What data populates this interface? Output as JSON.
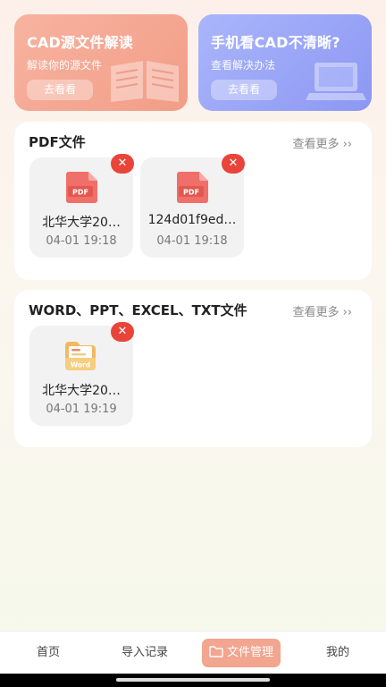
{
  "banners": [
    {
      "title": "CAD源文件解读",
      "subtitle": "解读你的源文件",
      "button": "去看看"
    },
    {
      "title": "手机看CAD不清晰?",
      "subtitle": "查看解决办法",
      "button": "去看看"
    }
  ],
  "pdf_section": {
    "title": "PDF文件",
    "more": "查看更多 ››",
    "files": [
      {
        "name": "北华大学20…",
        "time": "04-01 19:18",
        "icon_text": "PDF"
      },
      {
        "name": "124d01f9ed…",
        "time": "04-01 19:18",
        "icon_text": "PDF"
      }
    ]
  },
  "doc_section": {
    "title": "WORD、PPT、EXCEL、TXT文件",
    "more": "查看更多 ››",
    "files": [
      {
        "name": "北华大学20…",
        "time": "04-01 19:19",
        "icon_text": "Word"
      }
    ]
  },
  "delete_glyph": "✕",
  "nav": {
    "home": "首页",
    "import": "导入记录",
    "files": "文件管理",
    "mine": "我的"
  },
  "colors": {
    "accent": "#f2a58f",
    "pdf": "#ef6f6a",
    "delete": "#e9443a",
    "word": "#f3b95f"
  }
}
